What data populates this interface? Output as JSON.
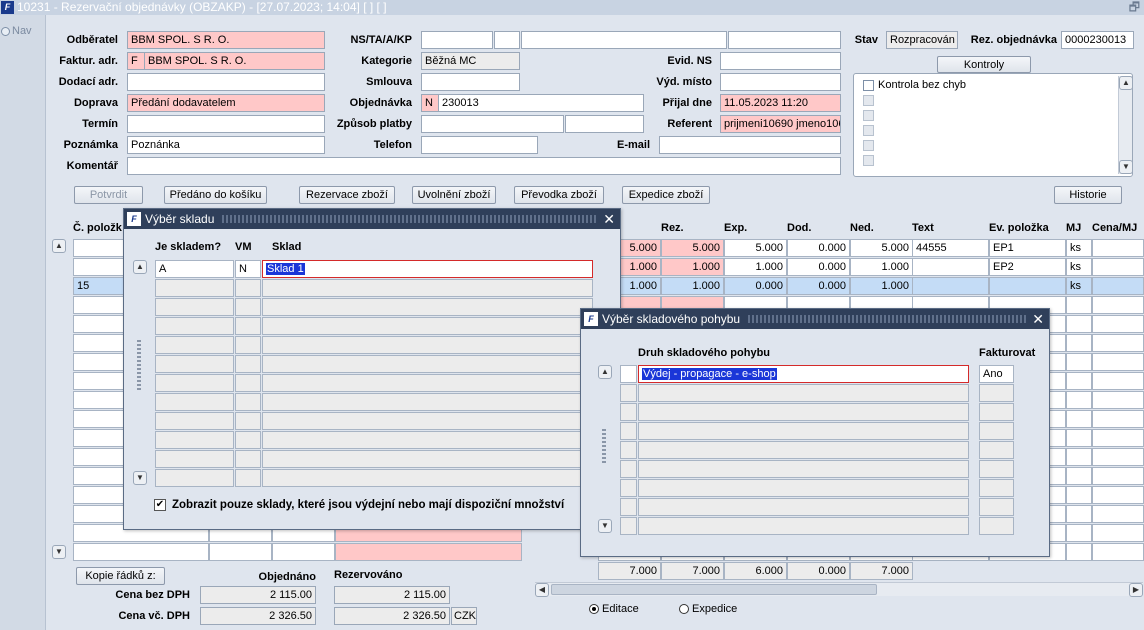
{
  "window": {
    "title": "10231 - Rezervační objednávky (OBZAKP) - [27.07.2023; 14:04]  [ ]  [ ]",
    "restore_glyph": "🗗",
    "app_icon_text": "F"
  },
  "nav": {
    "label": "Nav"
  },
  "header": {
    "odberatel_label": "Odběratel",
    "odberatel_value": "BBM SPOL. S R. O.",
    "faktur_label": "Faktur. adr.",
    "faktur_code": "F",
    "faktur_value": "BBM SPOL. S R. O.",
    "dodaci_label": "Dodací adr.",
    "dodaci_value": "",
    "doprava_label": "Doprava",
    "doprava_value": "Předání dodavatelem",
    "termin_label": "Termín",
    "termin_value": "",
    "poznamka_label": "Poznámka",
    "poznamka_value": "Poznánka",
    "komentar_label": "Komentář",
    "komentar_value": "",
    "ns_label": "NS/TA/A/KP",
    "kategorie_label": "Kategorie",
    "kategorie_value": "Běžná MC",
    "smlouva_label": "Smlouva",
    "smlouva_value": "",
    "objednavka_label": "Objednávka",
    "objednavka_code": "N",
    "objednavka_value": "230013",
    "zpusob_label": "Způsob platby",
    "telefon_label": "Telefon",
    "telefon_value": "",
    "evid_label": "Evid. NS",
    "evid_value": "",
    "vyd_label": "Výd. místo",
    "vyd_value": "",
    "prijal_label": "Přijal dne",
    "prijal_value": "11.05.2023 11:20",
    "referent_label": "Referent",
    "referent_value": "prijmeni10690 jmeno106",
    "email_label": "E-mail",
    "email_value": "",
    "stav_label": "Stav",
    "stav_value": "Rozpracován",
    "rez_label": "Rez. objednávka",
    "rez_value": "0000230013",
    "kontroly_button": "Kontroly",
    "kontrola_item": "Kontrola bez chyb"
  },
  "toolbar": {
    "potvrdit": "Potvrdit",
    "predano": "Předáno do košíku",
    "rezervace": "Rezervace zboží",
    "uvolneni": "Uvolnění zboží",
    "prevodka": "Převodka zboží",
    "expedice": "Expedice zboží",
    "historie": "Historie"
  },
  "grid": {
    "col_cislo": "Č. položk",
    "col_rez": "Rez.",
    "col_exp": "Exp.",
    "col_dod": "Dod.",
    "col_ned": "Ned.",
    "col_text": "Text",
    "col_ev": "Ev. položka",
    "col_mj": "MJ",
    "col_cena": "Cena/MJ",
    "rows": [
      {
        "cislo": "",
        "obj": "5.000",
        "rez": "5.000",
        "exp": "5.000",
        "dod": "0.000",
        "ned": "5.000",
        "text": "44555",
        "ev": "EP1",
        "mj": "ks"
      },
      {
        "cislo": "",
        "obj": "1.000",
        "rez": "1.000",
        "exp": "1.000",
        "dod": "0.000",
        "ned": "1.000",
        "text": "",
        "ev": "EP2",
        "mj": "ks"
      },
      {
        "cislo": "15",
        "obj": "1.000",
        "rez": "1.000",
        "exp": "0.000",
        "dod": "0.000",
        "ned": "1.000",
        "text": "",
        "ev": "",
        "mj": "ks"
      }
    ],
    "totals": {
      "obj": "7.000",
      "rez": "7.000",
      "exp": "6.000",
      "dod": "0.000",
      "ned": "7.000"
    }
  },
  "footer": {
    "kopie_button": "Kopie řádků z:",
    "objednano_label": "Objednáno",
    "rezervovano_label": "Rezervováno",
    "cena_bez_label": "Cena bez DPH",
    "cena_bez_obj": "2 115.00",
    "cena_bez_rez": "2 115.00",
    "cena_vc_label": "Cena vč. DPH",
    "cena_vc_obj": "2 326.50",
    "cena_vc_rez": "2 326.50",
    "currency": "CZK",
    "radio_editace": "Editace",
    "radio_expedice": "Expedice"
  },
  "dialog_sklad": {
    "title": "Výběr skladu",
    "col_skladem": "Je skladem?",
    "col_vm": "VM",
    "col_sklad": "Sklad",
    "row1": {
      "skladem": "A",
      "vm": "N",
      "sklad": "Sklad 1"
    },
    "checkbox_label": "Zobrazit pouze sklady, které jsou výdejní nebo mají dispoziční množství",
    "check_glyph": "✔"
  },
  "dialog_pohyb": {
    "title": "Výběr skladového pohybu",
    "col_druh": "Druh skladového pohybu",
    "col_fakt": "Fakturovat",
    "row1": {
      "druh": "Výdej - propagace - e-shop",
      "fakt": "Ano"
    }
  },
  "glyphs": {
    "up": "▲",
    "down": "▼",
    "left": "◀",
    "right": "▶",
    "close": "✕"
  }
}
